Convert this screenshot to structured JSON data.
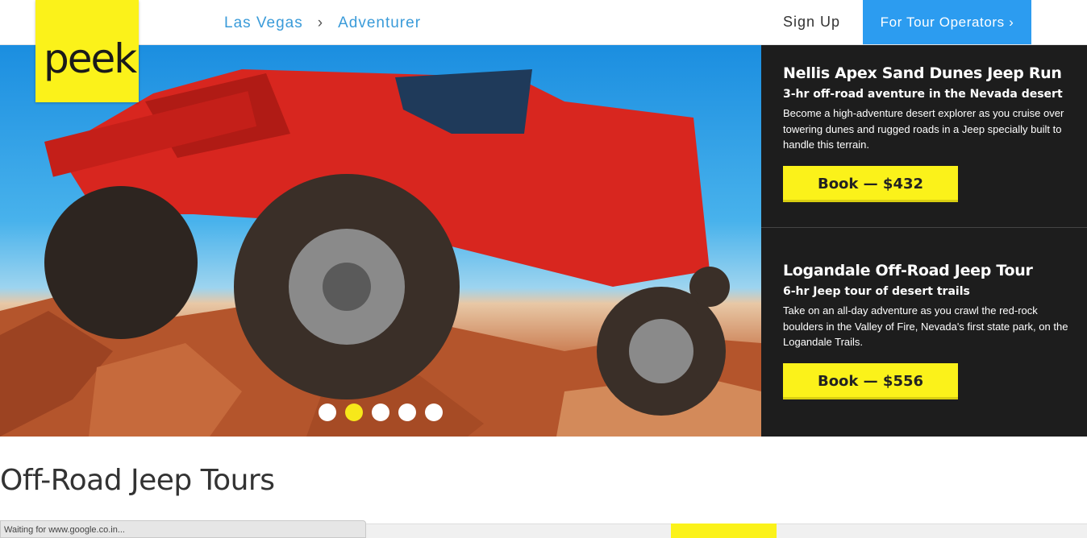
{
  "header": {
    "logo_text": "peek",
    "breadcrumb": [
      "Las Vegas",
      "Adventurer"
    ],
    "breadcrumb_separator": "›",
    "signup_label": "Sign Up",
    "operators_label": "For Tour Operators ›"
  },
  "carousel": {
    "slide_count": 5,
    "active_index": 1
  },
  "tours": [
    {
      "title": "Nellis Apex Sand Dunes Jeep Run",
      "subtitle": "3-hr off-road aventure in the Nevada desert",
      "description": "Become a high-adventure desert explorer as you cruise over towering dunes and rugged roads in a Jeep specially built to handle this terrain.",
      "book_label": "Book — $432"
    },
    {
      "title": "Logandale Off-Road Jeep Tour",
      "subtitle": "6-hr Jeep tour of desert trails",
      "description": "Take on an all-day adventure as you crawl the red-rock boulders in the Valley of Fire, Nevada's first state park, on the Logandale Trails.",
      "book_label": "Book — $556"
    }
  ],
  "page": {
    "section_title": "Off-Road Jeep Tours"
  },
  "status_bar": {
    "text": "Waiting for www.google.co.in..."
  },
  "colors": {
    "brand_yellow": "#fbf21a",
    "accent_blue": "#2c9cf0",
    "panel_dark": "#1d1d1d"
  }
}
